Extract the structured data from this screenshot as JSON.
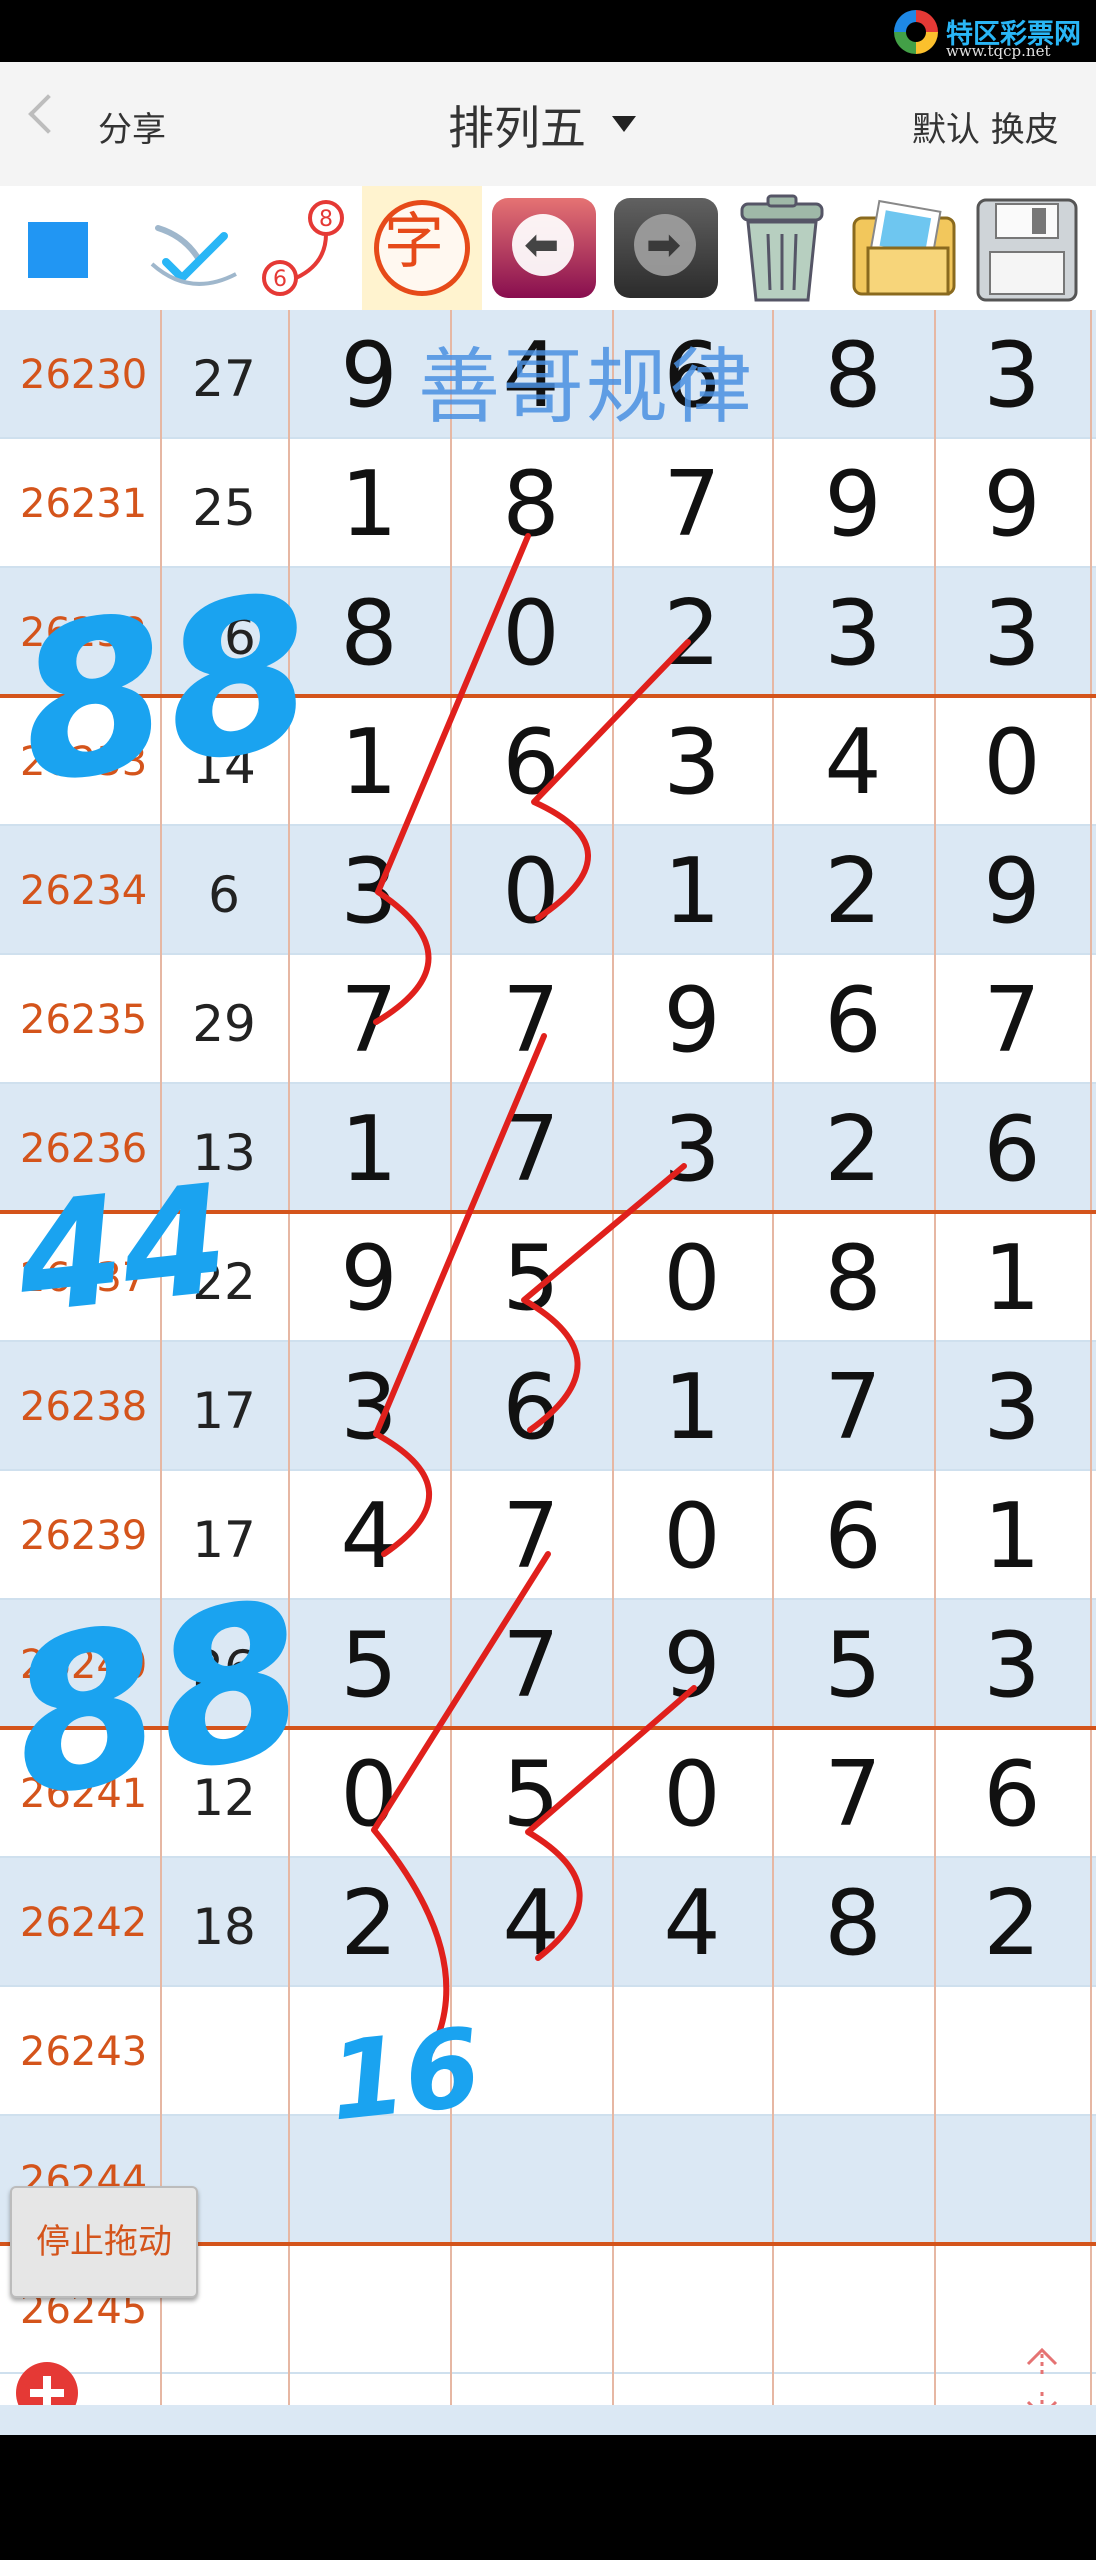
{
  "statusbar": {
    "logo_name": "特区彩票网",
    "logo_url": "www.tqcp.net"
  },
  "navbar": {
    "back": "<",
    "share": "分享",
    "title": "排列五",
    "skin": "默认 换皮"
  },
  "toolbar": {
    "icons": [
      "square-icon",
      "pen-check-icon",
      "route-icon",
      "zi-icon",
      "back-arrow-icon",
      "forward-arrow-icon",
      "trash-icon",
      "photos-icon",
      "save-disk-icon"
    ],
    "route_labels": {
      "top": "8",
      "bottom": "6"
    },
    "zi_char": "字",
    "accent_blue": "#2196f3",
    "accent_orange": "#e64a19"
  },
  "table": {
    "rows": [
      {
        "issue": "26230",
        "sum": "27",
        "digits": [
          "9",
          "4",
          "6",
          "8",
          "3"
        ]
      },
      {
        "issue": "26231",
        "sum": "25",
        "digits": [
          "1",
          "8",
          "7",
          "9",
          "9"
        ]
      },
      {
        "issue": "26232",
        "sum": "16",
        "digits": [
          "8",
          "0",
          "2",
          "3",
          "3"
        ]
      },
      {
        "issue": "26233",
        "sum": "14",
        "digits": [
          "1",
          "6",
          "3",
          "4",
          "0"
        ]
      },
      {
        "issue": "26234",
        "sum": "6",
        "digits": [
          "3",
          "0",
          "1",
          "2",
          "9"
        ]
      },
      {
        "issue": "26235",
        "sum": "29",
        "digits": [
          "7",
          "7",
          "9",
          "6",
          "7"
        ]
      },
      {
        "issue": "26236",
        "sum": "13",
        "digits": [
          "1",
          "7",
          "3",
          "2",
          "6"
        ]
      },
      {
        "issue": "26237",
        "sum": "22",
        "digits": [
          "9",
          "5",
          "0",
          "8",
          "1"
        ]
      },
      {
        "issue": "26238",
        "sum": "17",
        "digits": [
          "3",
          "6",
          "1",
          "7",
          "3"
        ]
      },
      {
        "issue": "26239",
        "sum": "17",
        "digits": [
          "4",
          "7",
          "0",
          "6",
          "1"
        ]
      },
      {
        "issue": "26240",
        "sum": "26",
        "digits": [
          "5",
          "7",
          "9",
          "5",
          "3"
        ]
      },
      {
        "issue": "26241",
        "sum": "12",
        "digits": [
          "0",
          "5",
          "0",
          "7",
          "6"
        ]
      },
      {
        "issue": "26242",
        "sum": "18",
        "digits": [
          "2",
          "4",
          "4",
          "8",
          "2"
        ]
      },
      {
        "issue": "26243",
        "sum": "",
        "digits": [
          "",
          "",
          "",
          "",
          ""
        ]
      },
      {
        "issue": "26244",
        "sum": "",
        "digits": [
          "",
          "",
          "",
          "",
          ""
        ]
      },
      {
        "issue": "26245",
        "sum": "",
        "digits": [
          "",
          "",
          "",
          "",
          ""
        ]
      }
    ],
    "separator_after_rows": [
      2,
      6,
      10,
      14
    ],
    "issue_color": "#d4541b"
  },
  "annotations": {
    "watermark": "善哥规律",
    "marks": [
      "88",
      "44",
      "88",
      "16"
    ],
    "mark_color": "#1aa3f0",
    "line_color": "#e0201c"
  },
  "controls": {
    "stop_drag": "停止拖动",
    "add_icon": "add-icon",
    "scroll_icon": "scroll-updown-icon"
  }
}
